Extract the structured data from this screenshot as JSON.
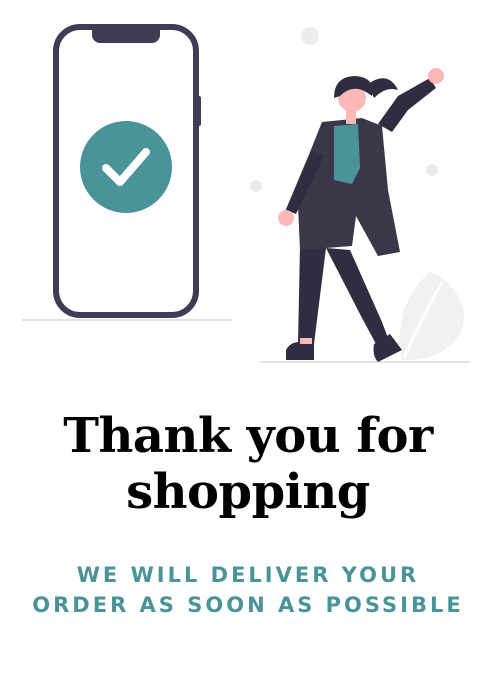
{
  "colors": {
    "accent": "#4a9499",
    "phone_frame": "#3f3d56",
    "figure_dark": "#2f2e41",
    "skin": "#ffb8b8",
    "decor": "#ececec"
  },
  "icons": {
    "checkmark": "check-icon"
  },
  "headline": {
    "line1": "Thank you for",
    "line2": "shopping"
  },
  "subline": {
    "line1": "WE WILL DELIVER YOUR",
    "line2": "ORDER AS SOON AS POSSIBLE"
  }
}
